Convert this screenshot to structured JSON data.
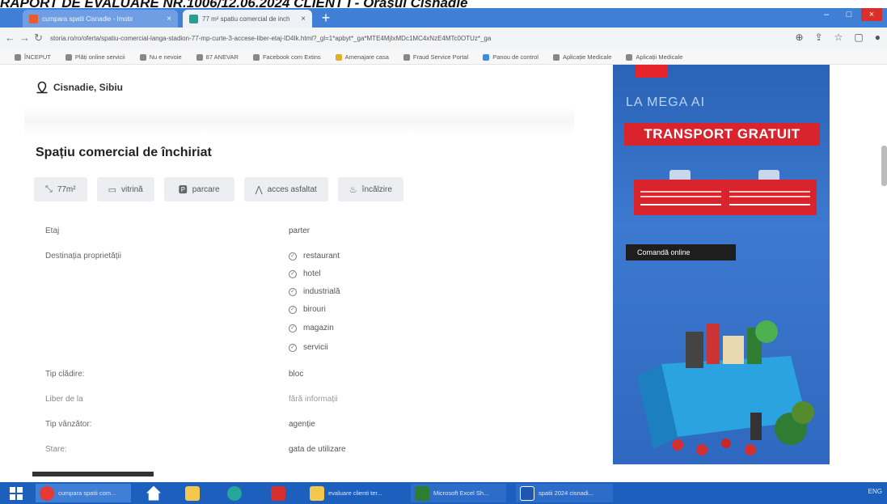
{
  "document_title": "RAPORT DE EVALUARE  NR.1006/12.06.2024 CLIENT I  - Oraşul Cisnădie",
  "browser": {
    "tabs": [
      {
        "label": "cumpara spatii Cisnadie - Imobi",
        "close": "×"
      },
      {
        "label": "77 m² spatiu comercial de inch",
        "close": "×"
      }
    ],
    "new_tab": "+",
    "window_controls": [
      "–",
      "□",
      "×"
    ],
    "url": "storia.ro/ro/oferta/spatiu-comercial-langa-stadion-77-mp-curte-3-accese-liber-etaj-ID4Ik.html?_gl=1*apbyt*_ga*MTE4MjIxMDc1MC4xNzE4MTc0OTUz*_ga",
    "bookmarks": [
      "ÎNCEPUT",
      "Plăți online servicii",
      "Nu e nevoie",
      "87 ANEVAR",
      "Facebook com Extins",
      "Amenajare casa",
      "Fraud Service Portal",
      "Panou de control",
      "Aplicație Medicale",
      "Aplicații Medicale"
    ]
  },
  "listing": {
    "location": "Cisnadie, Sibiu",
    "title": "Spațiu comercial de închiriat",
    "chips": [
      {
        "icon": "area-icon",
        "label": "77m²"
      },
      {
        "icon": "window-icon",
        "label": "vitrină"
      },
      {
        "icon": "parking-icon",
        "label": "parcare"
      },
      {
        "icon": "road-icon",
        "label": "acces asfaltat"
      },
      {
        "icon": "heating-icon",
        "label": "încălzire"
      }
    ],
    "details": {
      "floor_label": "Etaj",
      "floor_value": "parter",
      "destination_label": "Destinația proprietății",
      "destination_values": [
        "restaurant",
        "hotel",
        "industrială",
        "birouri",
        "magazin",
        "servicii"
      ],
      "building_type_label": "Tip clădire:",
      "building_type_value": "bloc",
      "available_from_label": "Liber de la",
      "available_from_value": "fără informații",
      "seller_type_label": "Tip vânzător:",
      "seller_type_value": "agenție",
      "condition_label": "Stare:",
      "condition_value": "gata de utilizare"
    }
  },
  "ad": {
    "line1": "LA MEGA AI",
    "line2": "TRANSPORT GRATUIT",
    "cta": "Comandă online"
  },
  "taskbar": {
    "items": [
      "cumpara spatii com...",
      "",
      "",
      "",
      "",
      "evaluare clienti ter...",
      "Microsoft Excel Sh...",
      "spatii 2024 cisnadi..."
    ],
    "tray": "ENG"
  },
  "colors": {
    "tabbar": "#3f7fd6",
    "taskbar": "#1c5fbd",
    "ad_blue": "#3d79cf",
    "ad_red": "#d9232d",
    "chip_bg": "#eceef2"
  }
}
